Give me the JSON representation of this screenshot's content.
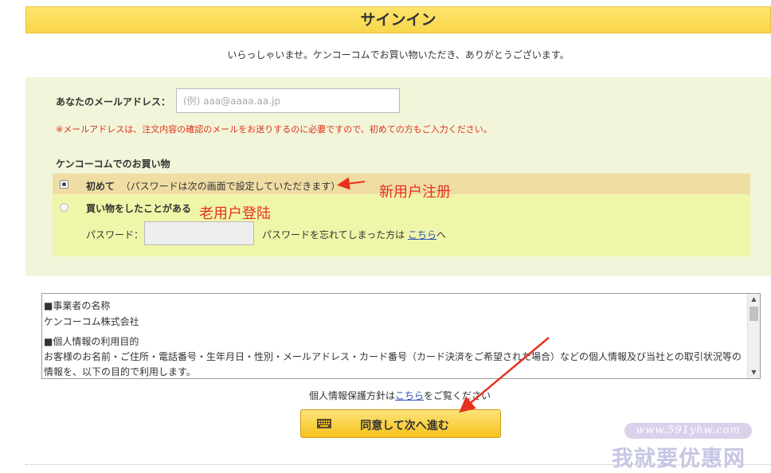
{
  "page": {
    "title": "サインイン",
    "welcome": "いらっしゃいませ。ケンコーコムでお買い物いただき、ありがとうございます。"
  },
  "email": {
    "label": "あなたのメールアドレス：",
    "placeholder": "(例) aaa@aaaa.aa.jp",
    "value": "",
    "note": "※メールアドレスは、注文内容の確認のメールをお送りするのに必要ですので、初めての方もご入力ください。"
  },
  "purchase": {
    "heading": "ケンコーコムでのお買い物",
    "option_first": {
      "label": "初めて",
      "hint": "（パスワードは次の画面で設定していただきます）",
      "checked": true
    },
    "option_returning": {
      "label": "買い物をしたことがある",
      "checked": false
    },
    "password_label": "パスワード：",
    "password_value": "",
    "forgot_prefix": "パスワードを忘れてしまった方は",
    "forgot_link": "こちら",
    "forgot_suffix": "へ"
  },
  "annotations": {
    "new_user": "新用户注册",
    "old_user": "老用户登陆",
    "agree": "同意",
    "color": "#e8301e"
  },
  "terms": {
    "items": [
      "■事業者の名称",
      "ケンコーコム株式会社",
      "■個人情報の利用目的",
      "お客様のお名前・ご住所・電話番号・生年月日・性別・メールアドレス・カード番号（カード決済をご希望された場合）などの個人情報及び当社との取引状況等の情報を、以下の目的で利用します。"
    ]
  },
  "policy": {
    "prefix": "個人情報保護方針は",
    "link": "こちら",
    "suffix": "をご覧ください"
  },
  "agree_button": {
    "label": "同意して次へ進む",
    "icon": "keyboard-icon"
  },
  "watermark": {
    "url": "www.591yhw.com",
    "name": "我就要优惠网"
  },
  "colors": {
    "title_bar": "#f9d64b",
    "panel": "#f2f5d9",
    "option_highlight": "#efdda4",
    "option_box": "#f0f6a9",
    "link": "#2a4fb5",
    "warning": "#e0311c"
  }
}
